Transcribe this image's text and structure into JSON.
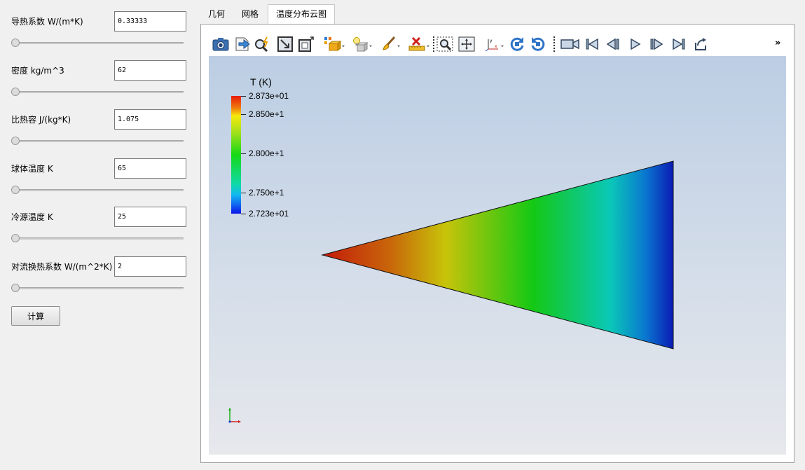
{
  "params": [
    {
      "label": "导热系数 W/(m*K)",
      "value": "0.33333",
      "slider": 0.0
    },
    {
      "label": "密度 kg/m^3",
      "value": "62",
      "slider": 0.0
    },
    {
      "label": "比热容 J/(kg*K)",
      "value": "1.075",
      "slider": 0.0
    },
    {
      "label": "球体温度 K",
      "value": "65",
      "slider": 0.0
    },
    {
      "label": "冷源温度 K",
      "value": "25",
      "slider": 0.0
    },
    {
      "label": "对流换热系数 W/(m^2*K)",
      "value": "2",
      "slider": 0.0
    }
  ],
  "calc_button": "计算",
  "tabs": [
    {
      "label": "几何"
    },
    {
      "label": "网格"
    },
    {
      "label": "温度分布云图",
      "active": true
    }
  ],
  "toolbar": {
    "buttons": [
      "camera-icon",
      "save-export-icon",
      "interact-probe-icon",
      "reset-camera-icon",
      "zoom-to-box-icon",
      "representation-icon",
      "light-bulb-icon",
      "paint-brush-icon",
      "clear-ruler-icon",
      "zoom-select-icon",
      "fit-view-icon",
      "axes-orientation-icon",
      "rotate-cw-icon",
      "rotate-ccw-icon",
      "video-camera-icon",
      "first-frame-icon",
      "prev-frame-icon",
      "play-icon",
      "next-frame-icon",
      "last-frame-icon",
      "loop-icon"
    ],
    "more_label": "»"
  },
  "legend": {
    "title": "T (K)",
    "labels": [
      "2.873e+01",
      "2.850e+1",
      "2.800e+1",
      "2.750e+1",
      "2.723e+01"
    ],
    "values": [
      28.73,
      28.5,
      28.0,
      27.5,
      27.23
    ],
    "range": [
      27.23,
      28.73
    ]
  },
  "colors": {
    "hot": "#c41a0a",
    "cold": "#0a1ab4",
    "viewport_top": "#bccee4",
    "viewport_bottom": "#e6e8ec"
  }
}
